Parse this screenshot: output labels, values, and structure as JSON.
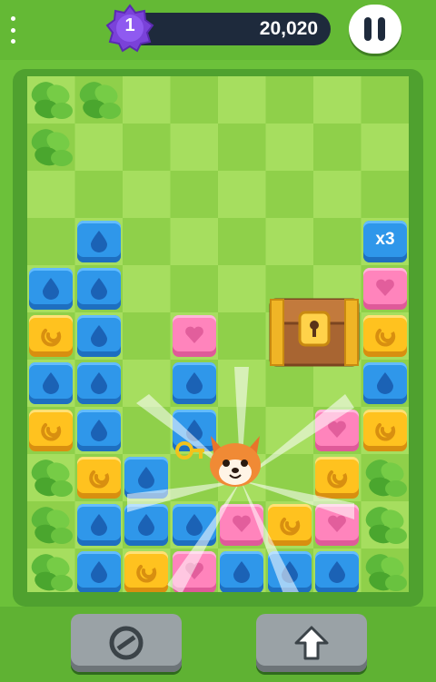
{
  "hud": {
    "level": "1",
    "score": "20,020"
  },
  "board": {
    "multiplier_label": "x3",
    "rows": [
      [
        "leaf",
        "leaf",
        "empty",
        "empty",
        "empty",
        "empty",
        "empty",
        "empty"
      ],
      [
        "leaf",
        "empty",
        "empty",
        "empty",
        "empty",
        "empty",
        "empty",
        "empty"
      ],
      [
        "empty",
        "empty",
        "empty",
        "empty",
        "empty",
        "empty",
        "empty",
        "empty"
      ],
      [
        "empty",
        "blue",
        "empty",
        "empty",
        "empty",
        "empty",
        "empty",
        "blue-x3"
      ],
      [
        "blue",
        "blue",
        "empty",
        "empty",
        "empty",
        "empty",
        "empty",
        "pink"
      ],
      [
        "yellow",
        "blue",
        "empty",
        "pink",
        "empty",
        "chest",
        "chest",
        "yellow"
      ],
      [
        "blue",
        "blue",
        "empty",
        "blue",
        "empty",
        "chest",
        "chest",
        "blue"
      ],
      [
        "yellow",
        "blue",
        "empty",
        "blue",
        "empty",
        "empty",
        "pink",
        "yellow"
      ],
      [
        "leaf",
        "yellow",
        "blue",
        "empty",
        "empty",
        "empty",
        "yellow",
        "leaf"
      ],
      [
        "leaf",
        "blue",
        "blue",
        "blue",
        "pink",
        "yellow",
        "pink",
        "leaf"
      ],
      [
        "leaf",
        "blue",
        "yellow",
        "pink",
        "blue",
        "blue",
        "blue",
        "leaf"
      ]
    ]
  },
  "controls": {
    "left_icon": "block-icon",
    "right_icon": "up-arrow-icon"
  },
  "colors": {
    "background": "#6cc13a",
    "blue": "#2f97ea",
    "yellow": "#ffc21f",
    "pink": "#ff84bc",
    "badge_purple": "#7a42d9",
    "scorebar": "#1e2a3c"
  }
}
